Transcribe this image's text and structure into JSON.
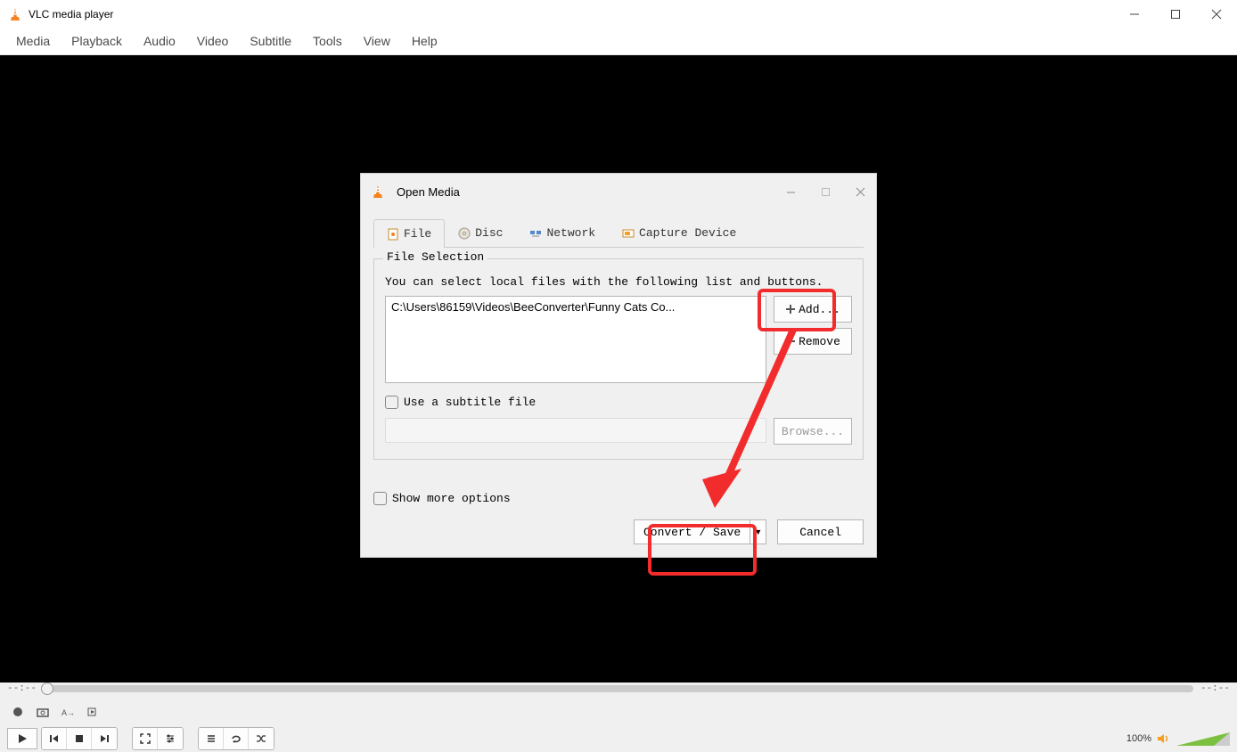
{
  "app": {
    "title": "VLC media player"
  },
  "menubar": [
    "Media",
    "Playback",
    "Audio",
    "Video",
    "Subtitle",
    "Tools",
    "View",
    "Help"
  ],
  "dialog": {
    "title": "Open Media",
    "tabs": [
      "File",
      "Disc",
      "Network",
      "Capture Device"
    ],
    "fieldset_legend": "File Selection",
    "hint": "You can select local files with the following list and buttons.",
    "file_path": "C:\\Users\\86159\\Videos\\BeeConverter\\Funny Cats Co...",
    "add_label": "Add...",
    "remove_label": "Remove",
    "subtitle_checkbox": "Use a subtitle file",
    "browse_label": "Browse...",
    "more_options": "Show more options",
    "convert_label": "Convert / Save",
    "cancel_label": "Cancel"
  },
  "player": {
    "time_left": "--:--",
    "time_right": "--:--",
    "volume_pct": "100%"
  }
}
